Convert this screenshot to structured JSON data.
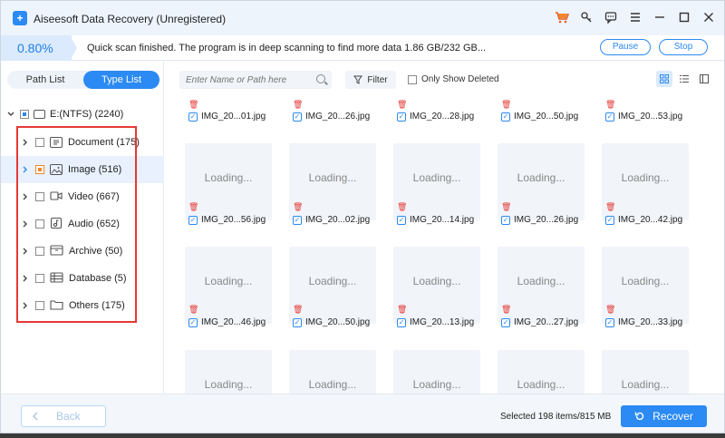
{
  "app": {
    "title": "Aiseesoft Data Recovery (Unregistered)"
  },
  "titlebar_icons": [
    "cart-icon",
    "key-icon",
    "chat-icon",
    "menu-icon",
    "minimize-icon",
    "maximize-icon",
    "close-icon"
  ],
  "progress": {
    "percent_text": "0.80%",
    "percent": 0.8,
    "message": "Quick scan finished. The program is in deep scanning to find more data 1.86 GB/232 GB...",
    "pause_label": "Pause",
    "stop_label": "Stop"
  },
  "sidebar": {
    "tabs": [
      "Path List",
      "Type List"
    ],
    "active_tab": "Type List",
    "root": {
      "label": "E:(NTFS) (2240)"
    },
    "items": [
      {
        "label": "Document (175)",
        "icon": "document-icon"
      },
      {
        "label": "Image (516)",
        "icon": "image-icon"
      },
      {
        "label": "Video (667)",
        "icon": "video-icon"
      },
      {
        "label": "Audio (652)",
        "icon": "audio-icon"
      },
      {
        "label": "Archive (50)",
        "icon": "archive-icon"
      },
      {
        "label": "Database (5)",
        "icon": "database-icon"
      },
      {
        "label": "Others (175)",
        "icon": "folder-icon"
      }
    ]
  },
  "toolbar": {
    "search_placeholder": "Enter Name or Path here",
    "filter_label": "Filter",
    "only_deleted_label": "Only Show Deleted"
  },
  "grid": {
    "loading_text": "Loading...",
    "rows": [
      [
        "IMG_20...01.jpg",
        "IMG_20...26.jpg",
        "IMG_20...28.jpg",
        "IMG_20...50.jpg",
        "IMG_20...53.jpg"
      ],
      [
        "IMG_20...56.jpg",
        "IMG_20...02.jpg",
        "IMG_20...14.jpg",
        "IMG_20...26.jpg",
        "IMG_20...42.jpg"
      ],
      [
        "IMG_20...46.jpg",
        "IMG_20...50.jpg",
        "IMG_20...13.jpg",
        "IMG_20...27.jpg",
        "IMG_20...33.jpg"
      ]
    ]
  },
  "bottom": {
    "back_label": "Back",
    "selected_text": "Selected 198 items/815 MB",
    "recover_label": "Recover"
  },
  "colors": {
    "accent": "#2b8af3",
    "highlight": "#e53935",
    "partial": "#f0892a"
  }
}
